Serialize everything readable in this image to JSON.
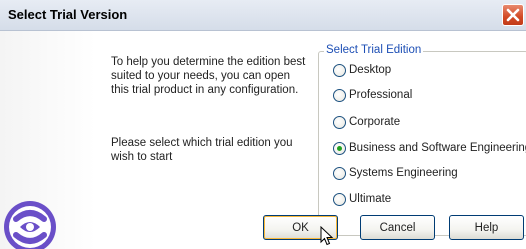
{
  "window": {
    "title": "Select Trial Version"
  },
  "intro_text": "To help you determine the edition best suited to your needs, you can open this trial product in any configuration.",
  "prompt_text": "Please select which trial edition you wish to start",
  "edition_group": {
    "legend": "Select Trial Edition",
    "options": [
      {
        "label": "Desktop",
        "checked": false
      },
      {
        "label": "Professional",
        "checked": false
      },
      {
        "label": "Corporate",
        "checked": false
      },
      {
        "label": "Business and Software Engineering",
        "checked": true
      },
      {
        "label": "Systems Engineering",
        "checked": false
      },
      {
        "label": "Ultimate",
        "checked": false
      }
    ]
  },
  "buttons": {
    "ok": "OK",
    "cancel": "Cancel",
    "help": "Help"
  },
  "icons": {
    "close": "close-icon",
    "logo": "app-logo-icon",
    "cursor": "mouse-cursor-icon"
  },
  "colors": {
    "legend": "#1d4fb5",
    "close_button": "#d24a25",
    "selected_radio": "#21a121",
    "button_border": "#003c74"
  }
}
